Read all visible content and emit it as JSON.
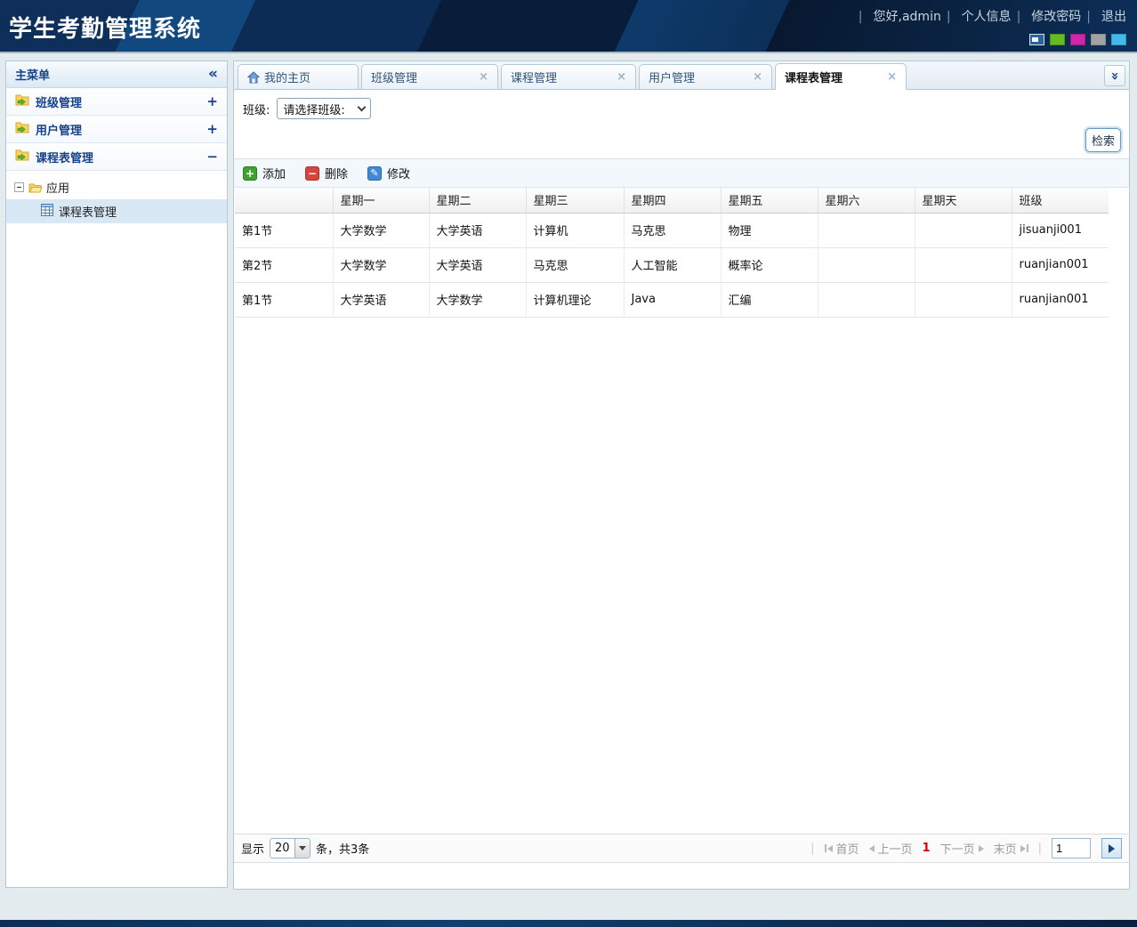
{
  "app": {
    "title": "学生考勤管理系统"
  },
  "header": {
    "greeting": "您好,admin",
    "profile": "个人信息",
    "change_password": "修改密码",
    "logout": "退出",
    "swatches": [
      {
        "name": "theme-default-blue",
        "color": "#2a64a0",
        "selected": true
      },
      {
        "name": "theme-green",
        "color": "#66bb22",
        "selected": false
      },
      {
        "name": "theme-magenta",
        "color": "#cc28a9",
        "selected": false
      },
      {
        "name": "theme-gray",
        "color": "#a2a2a2",
        "selected": false
      },
      {
        "name": "theme-skyblue",
        "color": "#47b7e9",
        "selected": false
      }
    ]
  },
  "sidebar": {
    "title": "主菜单",
    "menu": [
      {
        "label": "班级管理",
        "expand_sign": "+"
      },
      {
        "label": "用户管理",
        "expand_sign": "+"
      },
      {
        "label": "课程表管理",
        "expand_sign": "−"
      }
    ],
    "tree": {
      "parent": "应用",
      "child": "课程表管理"
    }
  },
  "tabs": [
    {
      "label": "我的主页"
    },
    {
      "label": "班级管理"
    },
    {
      "label": "课程管理"
    },
    {
      "label": "用户管理"
    },
    {
      "label": "课程表管理"
    }
  ],
  "filter": {
    "class_label": "班级:",
    "class_select_value": "请选择班级:",
    "search_button": "检索"
  },
  "toolbar": {
    "add": "添加",
    "delete": "删除",
    "edit": "修改"
  },
  "grid": {
    "headers": [
      "",
      "星期一",
      "星期二",
      "星期三",
      "星期四",
      "星期五",
      "星期六",
      "星期天",
      "班级"
    ],
    "rows": [
      [
        "第1节",
        "大学数学",
        "大学英语",
        "计算机",
        "马克思",
        "物理",
        "",
        "",
        "jisuanji001"
      ],
      [
        "第2节",
        "大学数学",
        "大学英语",
        "马克思",
        "人工智能",
        "概率论",
        "",
        "",
        "ruanjian001"
      ],
      [
        "第1节",
        "大学英语",
        "大学数学",
        "计算机理论",
        "Java",
        "汇编",
        "",
        "",
        "ruanjian001"
      ]
    ]
  },
  "pagination": {
    "show_label": "显示",
    "page_size": "20",
    "total_label": "条，共3条",
    "first": "首页",
    "prev": "上一页",
    "current_page": "1",
    "next": "下一页",
    "last": "末页",
    "page_input": "1"
  }
}
